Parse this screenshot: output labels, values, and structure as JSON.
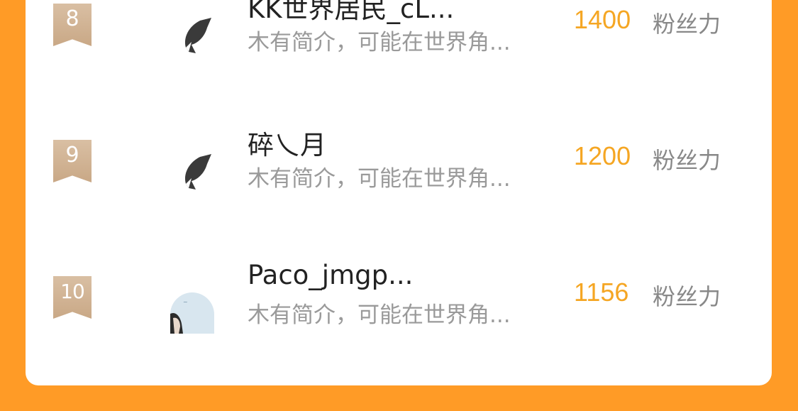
{
  "ranking": {
    "rows": [
      {
        "rank": "8",
        "username": "KK世界居民_cL...",
        "bio": "木有简介，可能在世界角...",
        "score": "1400",
        "score_unit": "粉丝力",
        "avatar_icon": "default-shark-avatar-icon"
      },
      {
        "rank": "9",
        "username": "碎乀月",
        "bio": "木有简介，可能在世界角...",
        "score": "1200",
        "score_unit": "粉丝力",
        "avatar_icon": "default-shark-avatar-icon"
      },
      {
        "rank": "10",
        "username": "Paco_jmgp...",
        "bio": "木有简介，可能在世界角...",
        "score": "1156",
        "score_unit": "粉丝力",
        "avatar_icon": "photo-avatar"
      }
    ]
  },
  "colors": {
    "background": "#FF9B26",
    "card": "#FFFFFF",
    "score": "#F5A623",
    "badge": "#C9A886",
    "username": "#222222",
    "bio": "#9A9A9A"
  }
}
